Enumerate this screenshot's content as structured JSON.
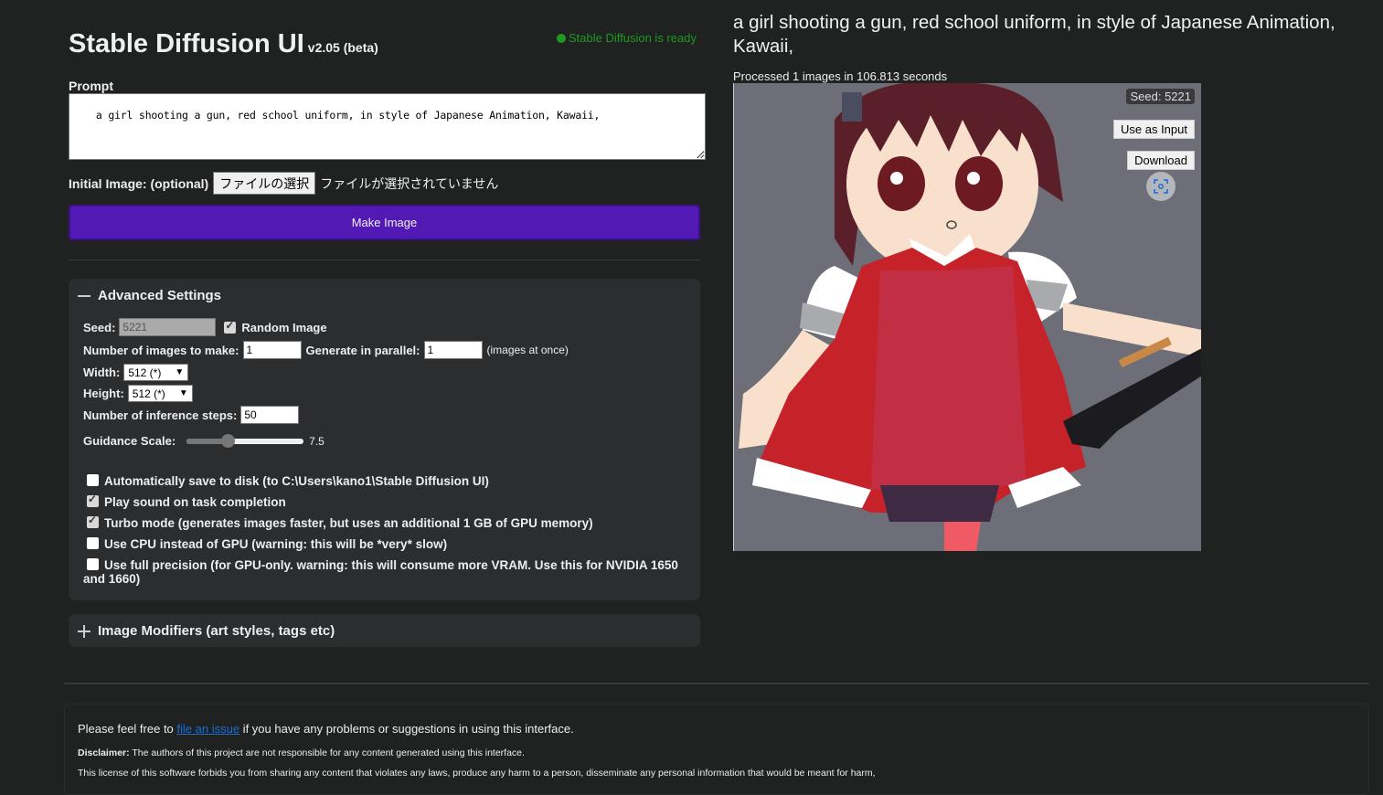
{
  "header": {
    "title": "Stable Diffusion UI",
    "version": "v2.05 (beta)",
    "status": "Stable Diffusion is ready",
    "status_color": "#1e9a1e"
  },
  "prompt": {
    "label": "Prompt",
    "value": "a girl shooting a gun, red school uniform, in style of Japanese Animation, Kawaii,"
  },
  "initial_image": {
    "label": "Initial Image: (optional)",
    "button_label": "ファイルの選択",
    "no_file_text": "ファイルが選択されていません"
  },
  "make_image": {
    "label": "Make Image",
    "color": "#5219b5"
  },
  "advanced": {
    "title": "Advanced Settings",
    "expanded": true,
    "seed_label": "Seed:",
    "seed_value": "5221",
    "random_label": "Random Image",
    "random_checked": true,
    "num_images_label": "Number of images to make:",
    "num_images_value": "1",
    "parallel_label": "Generate in parallel:",
    "parallel_value": "1",
    "parallel_note": "(images at once)",
    "width_label": "Width:",
    "width_value": "512 (*)",
    "height_label": "Height:",
    "height_value": "512 (*)",
    "steps_label": "Number of inference steps:",
    "steps_value": "50",
    "guidance_label": "Guidance Scale:",
    "guidance_value": "7.5",
    "guidance_fraction": 0.35,
    "options": [
      {
        "label": "Automatically save to disk (to C:\\Users\\kano1\\Stable Diffusion UI)",
        "checked": false
      },
      {
        "label": "Play sound on task completion",
        "checked": true
      },
      {
        "label": "Turbo mode (generates images faster, but uses an additional 1 GB of GPU memory)",
        "checked": true
      },
      {
        "label": "Use CPU instead of GPU (warning: this will be *very* slow)",
        "checked": false
      },
      {
        "label": "Use full precision (for GPU-only. warning: this will consume more VRAM. Use this for NVIDIA 1650 and 1660)",
        "checked": false
      }
    ]
  },
  "modifiers": {
    "title": "Image Modifiers (art styles, tags etc)",
    "expanded": false
  },
  "footer": {
    "line1_prefix": "Please feel free to ",
    "line1_link": "file an issue",
    "line1_suffix": " if you have any problems or suggestions in using this interface.",
    "disclaimer_label": "Disclaimer:",
    "disclaimer_text": " The authors of this project are not responsible for any content generated using this interface.",
    "license_text": "This license of this software forbids you from sharing any content that violates any laws, produce any harm to a person, disseminate any personal information that would be meant for harm,"
  },
  "output": {
    "prompt": "a girl shooting a gun, red school uniform, in style of Japanese Animation, Kawaii,",
    "processed": "Processed 1 images in 106.813 seconds",
    "seed_badge": "Seed: 5221",
    "use_as_input": "Use as Input",
    "download": "Download",
    "image_alt": "anime girl in red school uniform holding a gun"
  }
}
